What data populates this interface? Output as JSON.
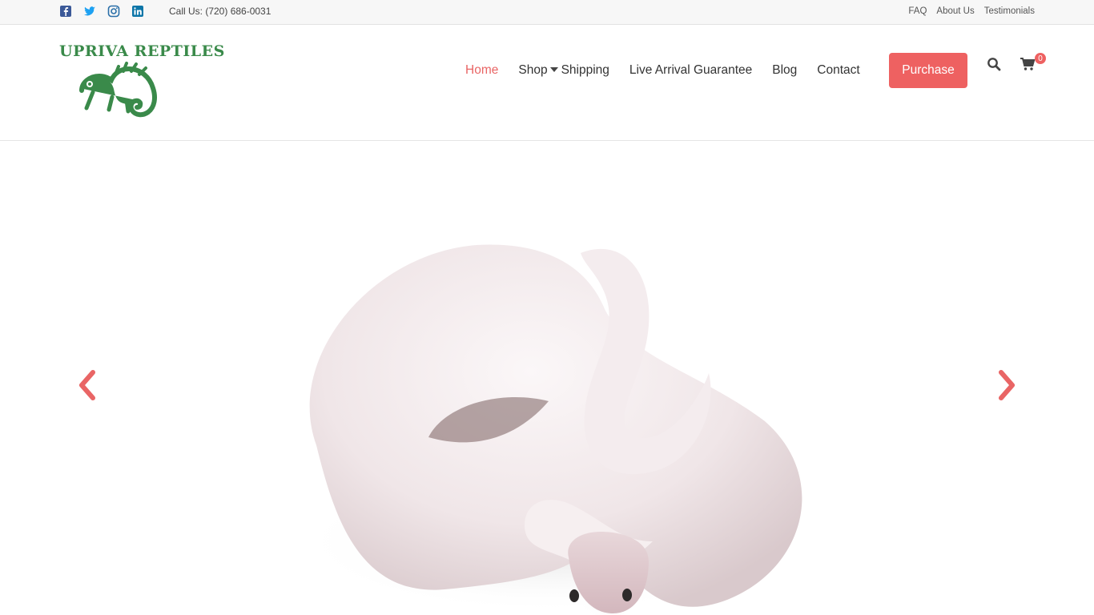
{
  "topbar": {
    "social": [
      {
        "icon": "facebook-icon",
        "color": "#3b5998"
      },
      {
        "icon": "twitter-icon",
        "color": "#1da1f2"
      },
      {
        "icon": "instagram-icon",
        "color": "#2a6fa8"
      },
      {
        "icon": "linkedin-icon",
        "color": "#0e76a8"
      }
    ],
    "call_us": "Call Us: (720) 686-0031",
    "links": [
      "FAQ",
      "About Us",
      "Testimonials"
    ]
  },
  "header": {
    "logo_text": "UPRIVA REPTILES",
    "nav": [
      "Home",
      "Shop",
      "Shipping",
      "Live Arrival Guarantee",
      "Blog",
      "Contact"
    ],
    "active_nav": "Home",
    "purchase_label": "Purchase",
    "cart_count": "0"
  },
  "colors": {
    "accent": "#ee6161",
    "logo_green": "#3a8a4a"
  },
  "hero": {
    "prev_icon": "chevron-left-icon",
    "next_icon": "chevron-right-icon"
  }
}
